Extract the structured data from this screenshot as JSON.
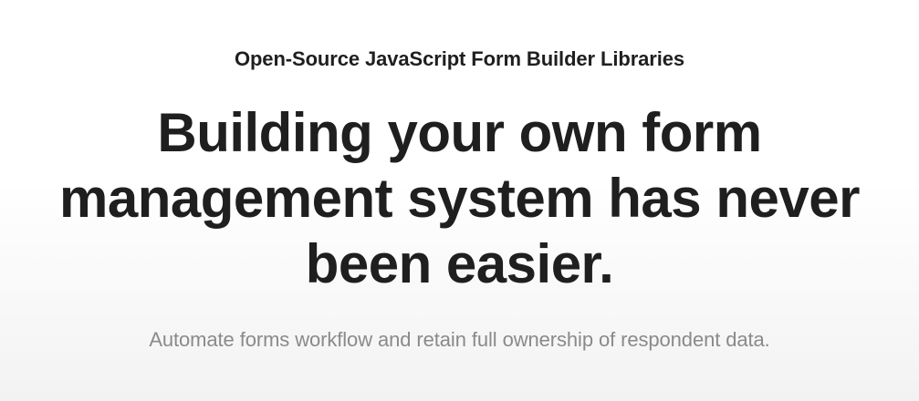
{
  "hero": {
    "eyebrow": "Open-Source JavaScript Form Builder Libraries",
    "headline_lines": [
      "Building your own form",
      "management system has never",
      "been easier."
    ],
    "subline": "Automate forms workflow and retain full ownership of respondent data."
  },
  "colors": {
    "text": "#1f1f1f",
    "muted": "#8a8a8a",
    "background": "#ffffff"
  }
}
